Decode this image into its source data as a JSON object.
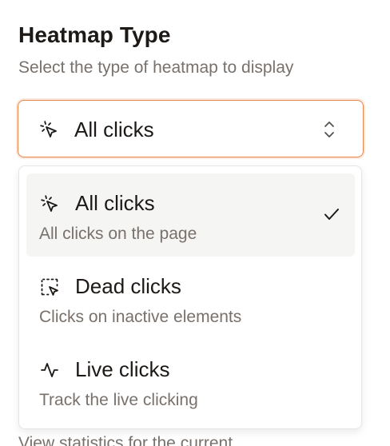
{
  "section": {
    "title": "Heatmap Type",
    "description": "Select the type of heatmap to display"
  },
  "select": {
    "value": "All clicks",
    "icon": "pointer-click-icon",
    "accent_color": "#e8864a"
  },
  "options": [
    {
      "title": "All clicks",
      "description": "All clicks on the page",
      "icon": "pointer-click-icon",
      "selected": true
    },
    {
      "title": "Dead clicks",
      "description": "Clicks on inactive elements",
      "icon": "dashed-selection-pointer-icon",
      "selected": false
    },
    {
      "title": "Live clicks",
      "description": "Track the live clicking",
      "icon": "activity-pulse-icon",
      "selected": false
    }
  ],
  "background_peek": {
    "next_description": "View statistics for the current"
  }
}
